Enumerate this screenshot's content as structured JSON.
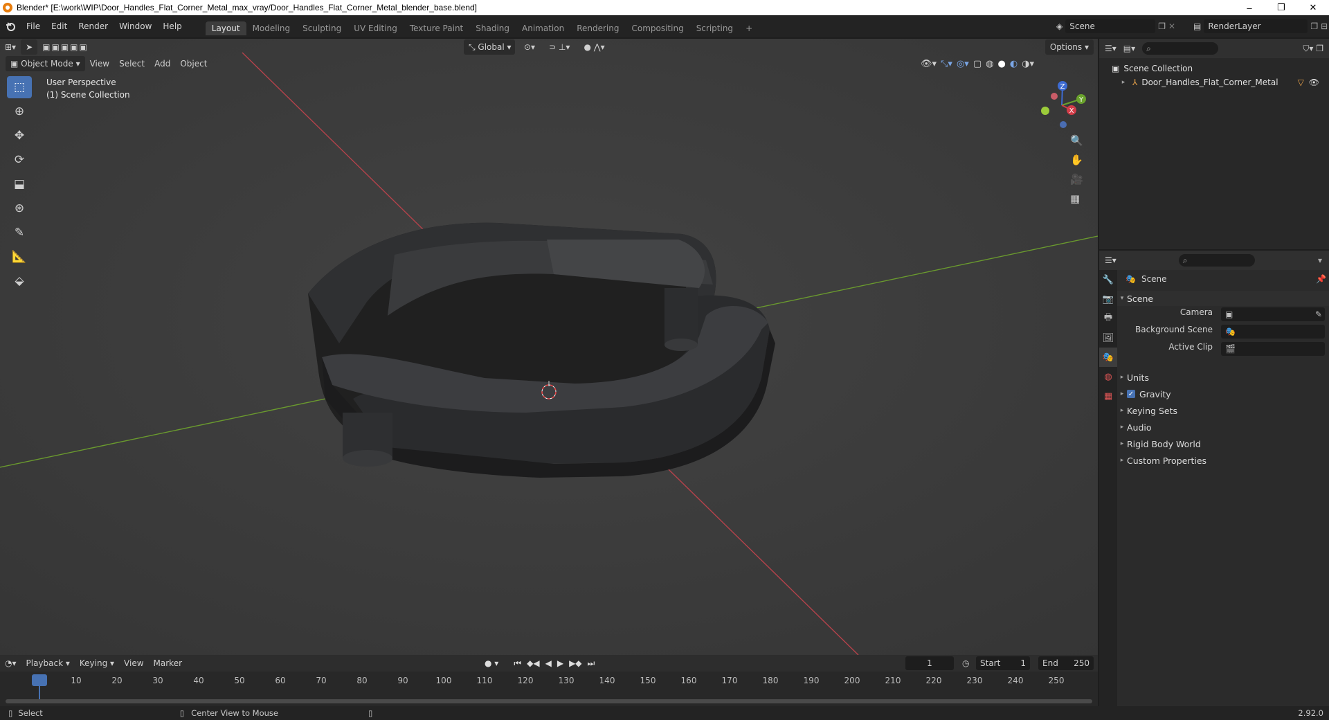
{
  "window": {
    "title": "Blender* [E:\\work\\WIP\\Door_Handles_Flat_Corner_Metal_max_vray/Door_Handles_Flat_Corner_Metal_blender_base.blend]",
    "minimize": "–",
    "maximize": "❐",
    "close": "✕"
  },
  "menubar": {
    "items": [
      "File",
      "Edit",
      "Render",
      "Window",
      "Help"
    ],
    "workspaces": [
      "Layout",
      "Modeling",
      "Sculpting",
      "UV Editing",
      "Texture Paint",
      "Shading",
      "Animation",
      "Rendering",
      "Compositing",
      "Scripting"
    ],
    "active_workspace": "Layout",
    "add_workspace": "+",
    "scene_name": "Scene",
    "render_layer": "RenderLayer"
  },
  "viewport": {
    "mode": "Object Mode",
    "menus": [
      "View",
      "Select",
      "Add",
      "Object"
    ],
    "transform_orientation": "Global",
    "options_label": "Options",
    "overlay_line1": "User Perspective",
    "overlay_line2": "(1) Scene Collection",
    "gizmo": {
      "x": "X",
      "y": "Y",
      "z": "Z"
    },
    "colors": {
      "background": "#3b3b3b",
      "x_axis": "#b5424b",
      "y_axis": "#6a9a2e",
      "select": "#4772b3"
    },
    "tools": [
      "select-box-icon",
      "cursor-icon",
      "move-icon",
      "rotate-icon",
      "scale-icon",
      "transform-icon",
      "annotate-icon",
      "measure-icon",
      "add-cube-icon"
    ],
    "nav": [
      "zoom-icon",
      "hand-icon",
      "camera-icon",
      "grid-icon"
    ]
  },
  "outliner": {
    "root": "Scene Collection",
    "items": [
      {
        "label": "Door_Handles_Flat_Corner_Metal"
      }
    ]
  },
  "properties": {
    "context": "Scene",
    "panel_title": "Scene",
    "fields": [
      {
        "label": "Camera",
        "value": ""
      },
      {
        "label": "Background Scene",
        "value": ""
      },
      {
        "label": "Active Clip",
        "value": ""
      }
    ],
    "subpanels": [
      {
        "label": "Units",
        "checkbox": false
      },
      {
        "label": "Gravity",
        "checkbox": true
      },
      {
        "label": "Keying Sets",
        "checkbox": false
      },
      {
        "label": "Audio",
        "checkbox": false
      },
      {
        "label": "Rigid Body World",
        "checkbox": false
      },
      {
        "label": "Custom Properties",
        "checkbox": false
      }
    ]
  },
  "timeline": {
    "menus": [
      "Playback",
      "Keying",
      "View",
      "Marker"
    ],
    "current_frame": "1",
    "start_label": "Start",
    "start": "1",
    "end_label": "End",
    "end": "250",
    "ticks": [
      "1",
      "10",
      "20",
      "30",
      "40",
      "50",
      "60",
      "70",
      "80",
      "90",
      "100",
      "110",
      "120",
      "130",
      "140",
      "150",
      "160",
      "170",
      "180",
      "190",
      "200",
      "210",
      "220",
      "230",
      "240",
      "250"
    ]
  },
  "statusbar": {
    "left": "Select",
    "middle": "Center View to Mouse",
    "version": "2.92.0"
  }
}
